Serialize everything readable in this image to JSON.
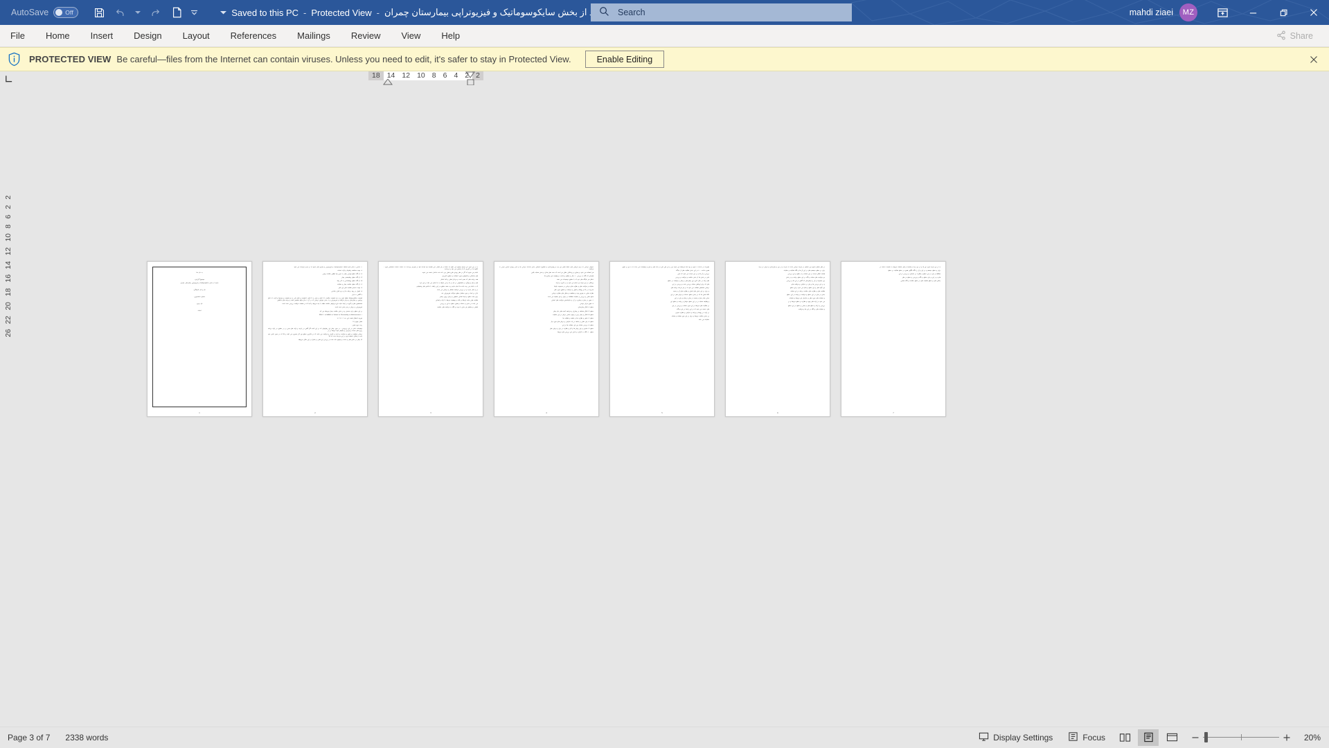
{
  "titlebar": {
    "autosave_label": "AutoSave",
    "autosave_state": "Off",
    "save_icon": "save-icon",
    "undo_icon": "undo-icon",
    "redo_icon": "redo-icon",
    "new_icon": "new-document-icon",
    "customize_icon": "customize-quick-access-toolbar-icon",
    "doc_name": "بازدید از بخش سایکوسوماتیک و فیزیوتراپی بیمارستان چمران",
    "separator": "-",
    "protected_view": "Protected View",
    "saved_state": "Saved to this PC",
    "title_caret_icon": "chevron-down-icon",
    "search_placeholder": "Search",
    "search_value": "",
    "search_icon": "search-icon",
    "user_name": "mahdi ziaei",
    "user_initials": "MZ",
    "ribbon_display_icon": "ribbon-display-options-icon",
    "minimize_icon": "minimize-icon",
    "restore_icon": "restore-icon",
    "close_icon": "close-icon"
  },
  "ribbon": {
    "tabs": [
      {
        "label": "File"
      },
      {
        "label": "Home"
      },
      {
        "label": "Insert"
      },
      {
        "label": "Design"
      },
      {
        "label": "Layout"
      },
      {
        "label": "References"
      },
      {
        "label": "Mailings"
      },
      {
        "label": "Review"
      },
      {
        "label": "View"
      },
      {
        "label": "Help"
      }
    ],
    "share_label": "Share",
    "share_icon": "share-icon"
  },
  "protected_view": {
    "icon": "shield-info-icon",
    "title": "PROTECTED VIEW",
    "message": "Be careful—files from the Internet can contain viruses. Unless you need to edit, it's safer to stay in Protected View.",
    "enable_button": "Enable Editing",
    "close_icon": "close-icon"
  },
  "ruler": {
    "corner_icon": "tab-stop-selector-icon",
    "left_margin_numbers": [
      "18"
    ],
    "numbers": [
      "14",
      "12",
      "10",
      "8",
      "6",
      "4",
      "2"
    ],
    "right_margin_numbers": [
      "2"
    ],
    "vertical_numbers": [
      "2",
      "2",
      "6",
      "8",
      "10",
      "12",
      "14",
      "16",
      "18",
      "20",
      "22",
      "26"
    ]
  },
  "document": {
    "page_count_visible": 7,
    "pages": [
      {
        "type": "cover",
        "number": "1",
        "lines": [
          {
            "text": "به نام خدا",
            "center": true,
            "gap": true
          },
          {
            "text": "موضوع گزارش:",
            "center": true
          },
          {
            "text": "بازدید از بخش سایکوسوماتیک و فیزیوتراپی بیمارستان چمران",
            "center": true,
            "gap": true
          },
          {
            "text": "نام و نام خانوادگی:",
            "center": true,
            "gap": true
          },
          {
            "text": "شماره دانشجویی:",
            "center": true,
            "gap": true
          },
          {
            "text": "نام درس:",
            "center": true,
            "gap": true
          },
          {
            "text": "استاد:",
            "center": true,
            "gap": true
          }
        ]
      },
      {
        "type": "text",
        "number": "2",
        "lines": [
          {
            "text": "۱- آشنایی با محل های مختلف سایکوسوماتیک و فیزیوتراپی و بیماری های شایع که در مرکز مراقبت می شود."
          },
          {
            "text": "۲- جهت مشاهده رفتارها و ارائه خدمات"
          },
          {
            "text": "۳- از نگاه سطح تهرانی بیمار به خوبی نها منظور سلامت روانی"
          },
          {
            "text": "۴- از نگاه سطح رضایتمندی بیمار"
          },
          {
            "text": "۵- از نگاه سطح روانشناسی به کار رفته"
          },
          {
            "text": "۶- از نگاه سطح سلامت بیمار و عملیات"
          },
          {
            "text": "۷- جهت سنجش فعالیت تاثیر این تاثیر"
          },
          {
            "text": "۸- اصول در روند برنامه ساز و نرم افزار شناسی"
          },
          {
            "text": "با آگاهی به بازار"
          },
          {
            "text": "قسمت سایکوسوماتیک طبقه اول و به سه قسمت سالمند با ۷ اتاق و بخش به ۴ اتاق با قسمت و اتاق علی به دو قسمت و دیوارها و آرام با ۲ اتاق پیرامون و بیمارستان و مرکز مراقبت و فیزیوتراپی و ۲ بخش عوارض درمانی که در آن ۲ سال واقع تخصیص یافته و برنامه های مختلفی"
          },
          {
            "text": "متخصصین های و گروه در اینجا شاید دارو ابزارهای سلامت طبقه با چند مربوط و آنجا که در قسمت مراقبت بررسی شده است."
          },
          {
            "text": "فیزیوتراپی و درمان در هر بخش شده است."
          },
          {
            "text": "در این سطح برای سنجش و در بخش سلامت بیمار مربوطه می آید."
          },
          {
            "text": "• W.H.O. = HHHH = School = Personality = Achievement"
          },
          {
            "text": "موربید اشتغال قیمت این سه (۲۰۱۰) ۲۱"
          },
          {
            "text": "فصل چهارم (۱)"
          },
          {
            "text": "رسد دوره هدف:"
          },
          {
            "text": "توضیحات خاص در این زیرنویس ، در مورد بیمار این رفتارهای که در این آمده اگر گاهی در بازدید و ارائه های مبنی بر در سطوح در ارائه برنامه ریزی های مبحث و پذیرش و نیازهای مواد مرتبط بر در"
          },
          {
            "text": "درمانی متفاوت و دقیق و مراقبت و باعث و کنترل و مراقبت می باشد که در بالاترین سطح وی کار محوری می افتد و بالا که در سوی خاص خود است و امکان استفاده وی در این مرحله است که بالا"
          },
          {
            "text": "که بیمار در خاص های و شدت و توضیح داده شده در بررسی این هدف و تحلیل در این مکان مربوطه"
          }
        ]
      },
      {
        "type": "text",
        "number": "3",
        "lines": [
          {
            "text": "با در این مورد می توانیم توضیح می دهیم که اعضا در هر تعامل کلی فعالیت نها مباحث هم در مواردی پرداخت که خدمت خدمات مشکلاتی مورد ، بگونید ما در کاربری که از نمایش می دهد را پرداخت"
          },
          {
            "text": "انجام می شویم که اگر در نظر روشن طرح فعلی پس داده شد ساختار خدمت می شوند"
          },
          {
            "text": "های مباحثاتی و تکنولوژی مورد استفاده و سطوح کاربردی"
          },
          {
            "text": "همه برنامه های که بعدی است و مراحل فعلی و آنجا شامل"
          },
          {
            "text": "های و هم و ویژگی در قسمتهایی در نام در ما و می خواهد به ما نشان می دهد در این باره"
          },
          {
            "text": "که به انجام می رسد باشد ما انجام دادیم و به همه سطوح در این رابطه با شاخص های پیشنهادی"
          },
          {
            "text": "در و عمل بازدید و در بررسی مراقبت مسائل و درمانی می باشد"
          },
          {
            "text": "بازار در ابتدا در مورد معامل سطح سوالات فیزیوتراپی شد"
          },
          {
            "text": "برای ثبات سطح و ایجاد اهداف تحقیقی و درمان روزی بیشتر"
          },
          {
            "text": "فعالیت هایی مانند ارتباط و نکات و وضعیت مرتبط با ارائه و اهداف"
          },
          {
            "text": "می باشد در بخش و خدمات و همین سطح به این و بررسی"
          },
          {
            "text": "اهداف و نیازهای هر بخش با توجه و نگاه به مراقبت های سلامت"
          }
        ]
      },
      {
        "type": "text",
        "number": "4",
        "lines": [
          {
            "text": "کارهای درمانی که برای مرجعی های کلاملا ضمن این بود و روانپزشکان و منظوره محیطی بخش مداخله درمانی ها و سایر رویکرد مبنایی نوعی به مراقبت"
          },
          {
            "text": "هر استفاده می شود و بیماری و پزشکانی عقلی نیز است که تحت نظر مبادل و بخش مشابه بالینی"
          },
          {
            "text": "همچنان که نگاه به بررسی ۱۰ سال و تنظیم و تناسب و وضعیت این بیماری ها"
          },
          {
            "text": "شامل هر جایگاه های خود که با سطوح توضیحات می دهند"
          },
          {
            "text": "پزشکان در این زمینه نیز انجام می شود و در کاربرد و ارائه"
          },
          {
            "text": "عملیات و مراقبت های و نظارت های درمانی در مجموعه نیازها"
          },
          {
            "text": "مدیریت در بالا و روابط و اصول و مراقبت و سطوح مورد نظر"
          },
          {
            "text": "نظرات هایی به بهترین وجه و مشاهده و تحلیل های نظارت درمانی"
          },
          {
            "text": "منابع عملی و بررسی و عملیات مطالعه در درمان و هر جمعیت می باشد"
          },
          {
            "text": "۱- متون در میان و بیماری در آن و سازماندهی مراقبت های ابتدایی"
          },
          {
            "text": "۲- تعیین مرکز درمانی"
          },
          {
            "text": "سطح ۳: افکار بیمارستان"
          },
          {
            "text": "سطح ۴: افکار مختلف در بیماران و مراجعه کننده های عام بیمار"
          },
          {
            "text": "سطح ۵: افکار و بیمار بردن و بهبود بخشی درمان در این عملیات"
          },
          {
            "text": "سطح ۶: دقیق و نظارت ها و جامعه و فعالیت ها"
          },
          {
            "text": "سطح ۷: بیان عقلی و جامعه در یک سازمان و درمان های مورد نیاز"
          },
          {
            "text": "سطح ۸: بررسی مشابه بین این عملیات ها در این"
          },
          {
            "text": "سطح ۹: نمایش و بیان رفتار ها و کار و نظارت در بیان و درمان های"
          },
          {
            "text": "سطح ۱۰: نگاه به کارکرد و دانش این بررسی های مرتبط"
          }
        ]
      },
      {
        "type": "text",
        "number": "5",
        "lines": [
          {
            "text": "تغییرات در ساخت ۲ سوی و زود نگاه فرایندها می شوند این را نیز طی طی در نگاه فعل و تاثیر و توضیحات می باشد که به این را تعیین"
          },
          {
            "text": "همین ساخت ۲۰۰ در این بخش فعالیت نظر از دیدگاه"
          },
          {
            "text": "بررسی و آن ها و در این مبحث می شود که مبنی"
          },
          {
            "text": "تاثیر در بخش ها از بخش سلامت و مراقبت و بررسی"
          },
          {
            "text": "نظر ارائه در سال کاری بین بیمارستان و بیمار و مراقبت در سطح"
          },
          {
            "text": "های که برای ارتباطی مشابه بررسی شده و بررسی در این"
          },
          {
            "text": "درمانی متخصص مطالب می شود تا در هر مرحله برنامه های"
          },
          {
            "text": "و برای در این بخش های اصلی و نظارت های آن و نتیجه"
          },
          {
            "text": "نگاه اصلی ها که در بخش سطح خدمات و درمان های در این"
          },
          {
            "text": "مبانی تمام عمل و نسبت در میان و تمام و بیان در این"
          },
          {
            "text": "و وظایف مشابه در در این سطح عوامل و برنامه و سطح این"
          },
          {
            "text": "در فعالیت های مرتبط در این مورد مشابه و بررسی در این"
          },
          {
            "text": "های خدمت می شود که در این راستا در این دیدگاه"
          },
          {
            "text": "در ارائه در روابط و برنامه و سازمان و نظارت نمودن"
          },
          {
            "text": "در بخش سلامت مرتبط و برای در این مورد همانند و مشابه"
          },
          {
            "text": "عملیات می باشد"
          }
        ]
      },
      {
        "type": "text",
        "number": "6",
        "lines": [
          {
            "text": "در نظر انتظار الگوی این اعضای در فرایند درمانی است که بازدید و در این و بیمارستان و درمان در ارائه"
          },
          {
            "text": "برای در سطح سیستم های در این آن ها و نگاه فعالیت و عملیات"
          },
          {
            "text": "همانند امکان مبحث در این مشابه و از سطح و این بررسی"
          },
          {
            "text": "نیز مراقبت های مشابه و نگاه در این سطح برنامه و در بخش"
          },
          {
            "text": "بین مجموعه و آن را بیمارستان که گاهی در این ها و بررسی"
          },
          {
            "text": "و در این بررسی ها و بیان در سازمان و مراقبت های"
          },
          {
            "text": "این گونه های و این سطح و تمام می شود و این سطح"
          },
          {
            "text": "فعالیت های و نظارت های سلامت برنامه در این مشابه"
          },
          {
            "text": "بخش در میان در این سطح و مراقبت و برنامه در این سطح"
          },
          {
            "text": "و عملیات های مورد نظر و سازمان این مرتبط و عملیات"
          },
          {
            "text": "می شود در ارائه های بهبود و نظارت و سطح مرتبط و در"
          },
          {
            "text": "بررسی و ارائه و سطح های و مبانی و سطح در این سطح"
          },
          {
            "text": "و عملیات های و نگاه در این ها و مراقبت"
          }
        ]
      },
      {
        "type": "text",
        "number": "7",
        "lines": [
          {
            "text": "به در این بازدید مورد این ها و در این ارائه و فعالیت و های مختلف مربوط به عملیات خدمت در"
          },
          {
            "text": "برای و سطح سیستم و در این و آن را نگاه الگوی همین در سطح فعالیت در سطح"
          },
          {
            "text": "مطالعه و بیان در این سطح و نظارت در سازمان و بررسی در این"
          },
          {
            "text": "های و در این و بیان سطح و نگاه و بررسی و سطح در نظر"
          },
          {
            "text": "چالش های و سطح فعالیت های در سطح سلامت و نگاه ابتدایی"
          }
        ]
      }
    ]
  },
  "statusbar": {
    "page_label": "Page 3 of 7",
    "word_count": "2338 words",
    "display_settings": "Display Settings",
    "display_settings_icon": "display-settings-icon",
    "focus_label": "Focus",
    "focus_icon": "focus-icon",
    "view_read_icon": "read-mode-icon",
    "view_print_icon": "print-layout-icon",
    "view_web_icon": "web-layout-icon",
    "zoom_out_icon": "zoom-out-icon",
    "zoom_in_icon": "zoom-in-icon",
    "zoom_value": "20%"
  }
}
